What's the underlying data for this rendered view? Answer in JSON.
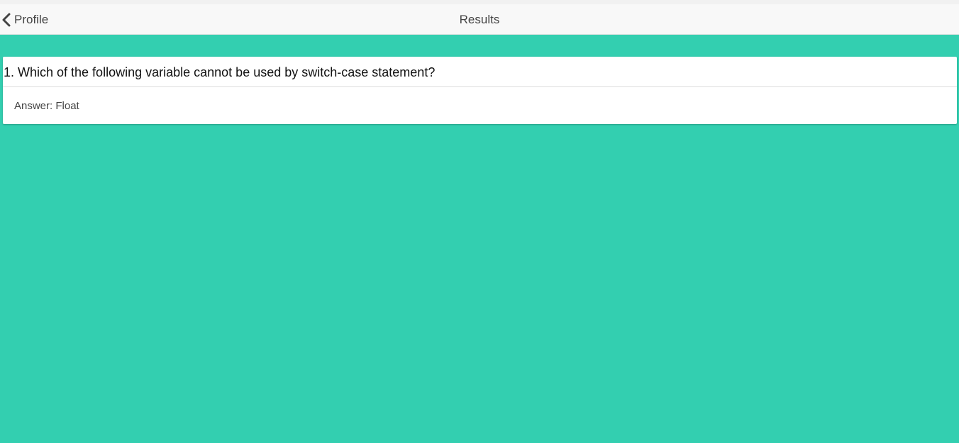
{
  "header": {
    "back_label": "Profile",
    "title": "Results"
  },
  "results": [
    {
      "question": "1. Which of the following variable cannot be used by switch-case statement?",
      "answer": "Answer: Float"
    }
  ],
  "icons": {
    "back": "chevron-left-icon"
  },
  "colors": {
    "background": "#33cfb0",
    "navbar": "#f8f8f8",
    "card": "#ffffff"
  }
}
